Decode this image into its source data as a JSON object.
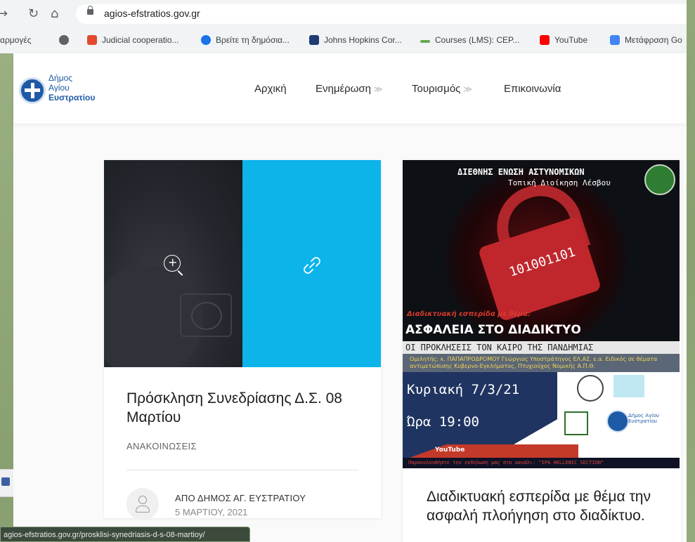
{
  "browser": {
    "url": "agios-efstratios.gov.gr",
    "bookmarks": [
      {
        "label": "αρμογές",
        "icon": "apps-icon",
        "color": "#4a6fd6"
      },
      {
        "label": "",
        "icon": "globe-icon",
        "color": "#5f6368"
      },
      {
        "label": "Judicial cooperatio...",
        "icon": "eu-flag-icon",
        "color": "#e2492f"
      },
      {
        "label": "Βρείτε τη δημόσια...",
        "icon": "info-circle-icon",
        "color": "#1a73e8"
      },
      {
        "label": "Johns Hopkins Cor...",
        "icon": "shield-icon",
        "color": "#1e3c72"
      },
      {
        "label": "Courses (LMS): CEP...",
        "icon": "wave-icon",
        "color": "#6aa84f"
      },
      {
        "label": "YouTube",
        "icon": "youtube-icon",
        "color": "#ff0000"
      },
      {
        "label": "Μετάφραση Go",
        "icon": "translate-icon",
        "color": "#4285f4"
      }
    ]
  },
  "site": {
    "logo_lines": [
      "Δήμος",
      "Αγίου",
      "Ευστρατίου"
    ],
    "nav": [
      {
        "label": "Αρχική",
        "has_submenu": false
      },
      {
        "label": "Ενημέρωση",
        "has_submenu": true
      },
      {
        "label": "Τουρισμός",
        "has_submenu": true
      },
      {
        "label": "Επικοινωνία",
        "has_submenu": false
      }
    ],
    "chevron": "≫",
    "post1": {
      "title": "Πρόσκληση Συνεδρίασης Δ.Σ. 08 Μαρτίου",
      "category": "ΑΝΑΚΟΙΝΩΣΕΙΣ",
      "author": "ΑΠΟ ΔΗΜΟΣ ΑΓ. ΕΥΣΤΡΑΤΙΟΥ",
      "date": "5 ΜΑΡΤΙΟΥ, 2021"
    },
    "post2": {
      "title": "Διαδικτυακή εσπερίδα με θέμα την ασφαλή πλοήγηση στο διαδίκτυο.",
      "poster": {
        "org": "ΔΙΕΘΝΗΣ ΕΝΩΣΗ ΑΣΤΥΝΟΜΙΚΩΝ",
        "org_sub": "Τοπική Διοίκηση Λέσβου",
        "binary": "101001101",
        "intro": "Διαδικτυακή εσπερίδα με θέμα:",
        "headline": "ΑΣΦΑΛΕΙΑ ΣΤΟ ΔΙΑΔΙΚΤΥΟ",
        "subheadline": "ΟΙ ΠΡΟΚΛΗΣΕΙΣ ΤΟΝ ΚΑΙΡΟ ΤΗΣ ΠΑΝΔΗΜΙΑΣ",
        "speaker": "Ομιλητής: κ. ΠΑΠΑΠΡΟΔΡΟΜΟΥ Γεώργιος Υποστράτηγος ΕΛ.ΑΣ. ε.α. Ειδικός σε θέματα αντιμετώπισης Κυβερνο-Εγκλήματος, Πτυχιούχος Νομικής Α.Π.Θ.",
        "day": "Κυριακή 7/3/21",
        "time": "Ώρα 19:00",
        "youtube": "YouTube",
        "logo_text": "Δήμος Αγίου Ευστρατίου",
        "footer": "Παρακολουθήστε την εκδήλωση μας στο κανάλι: \"IPA HELLENIC SECTION\""
      }
    }
  },
  "status_url": "agios-efstratios.gov.gr/prosklisi-synedriasis-d-s-08-martioy/"
}
